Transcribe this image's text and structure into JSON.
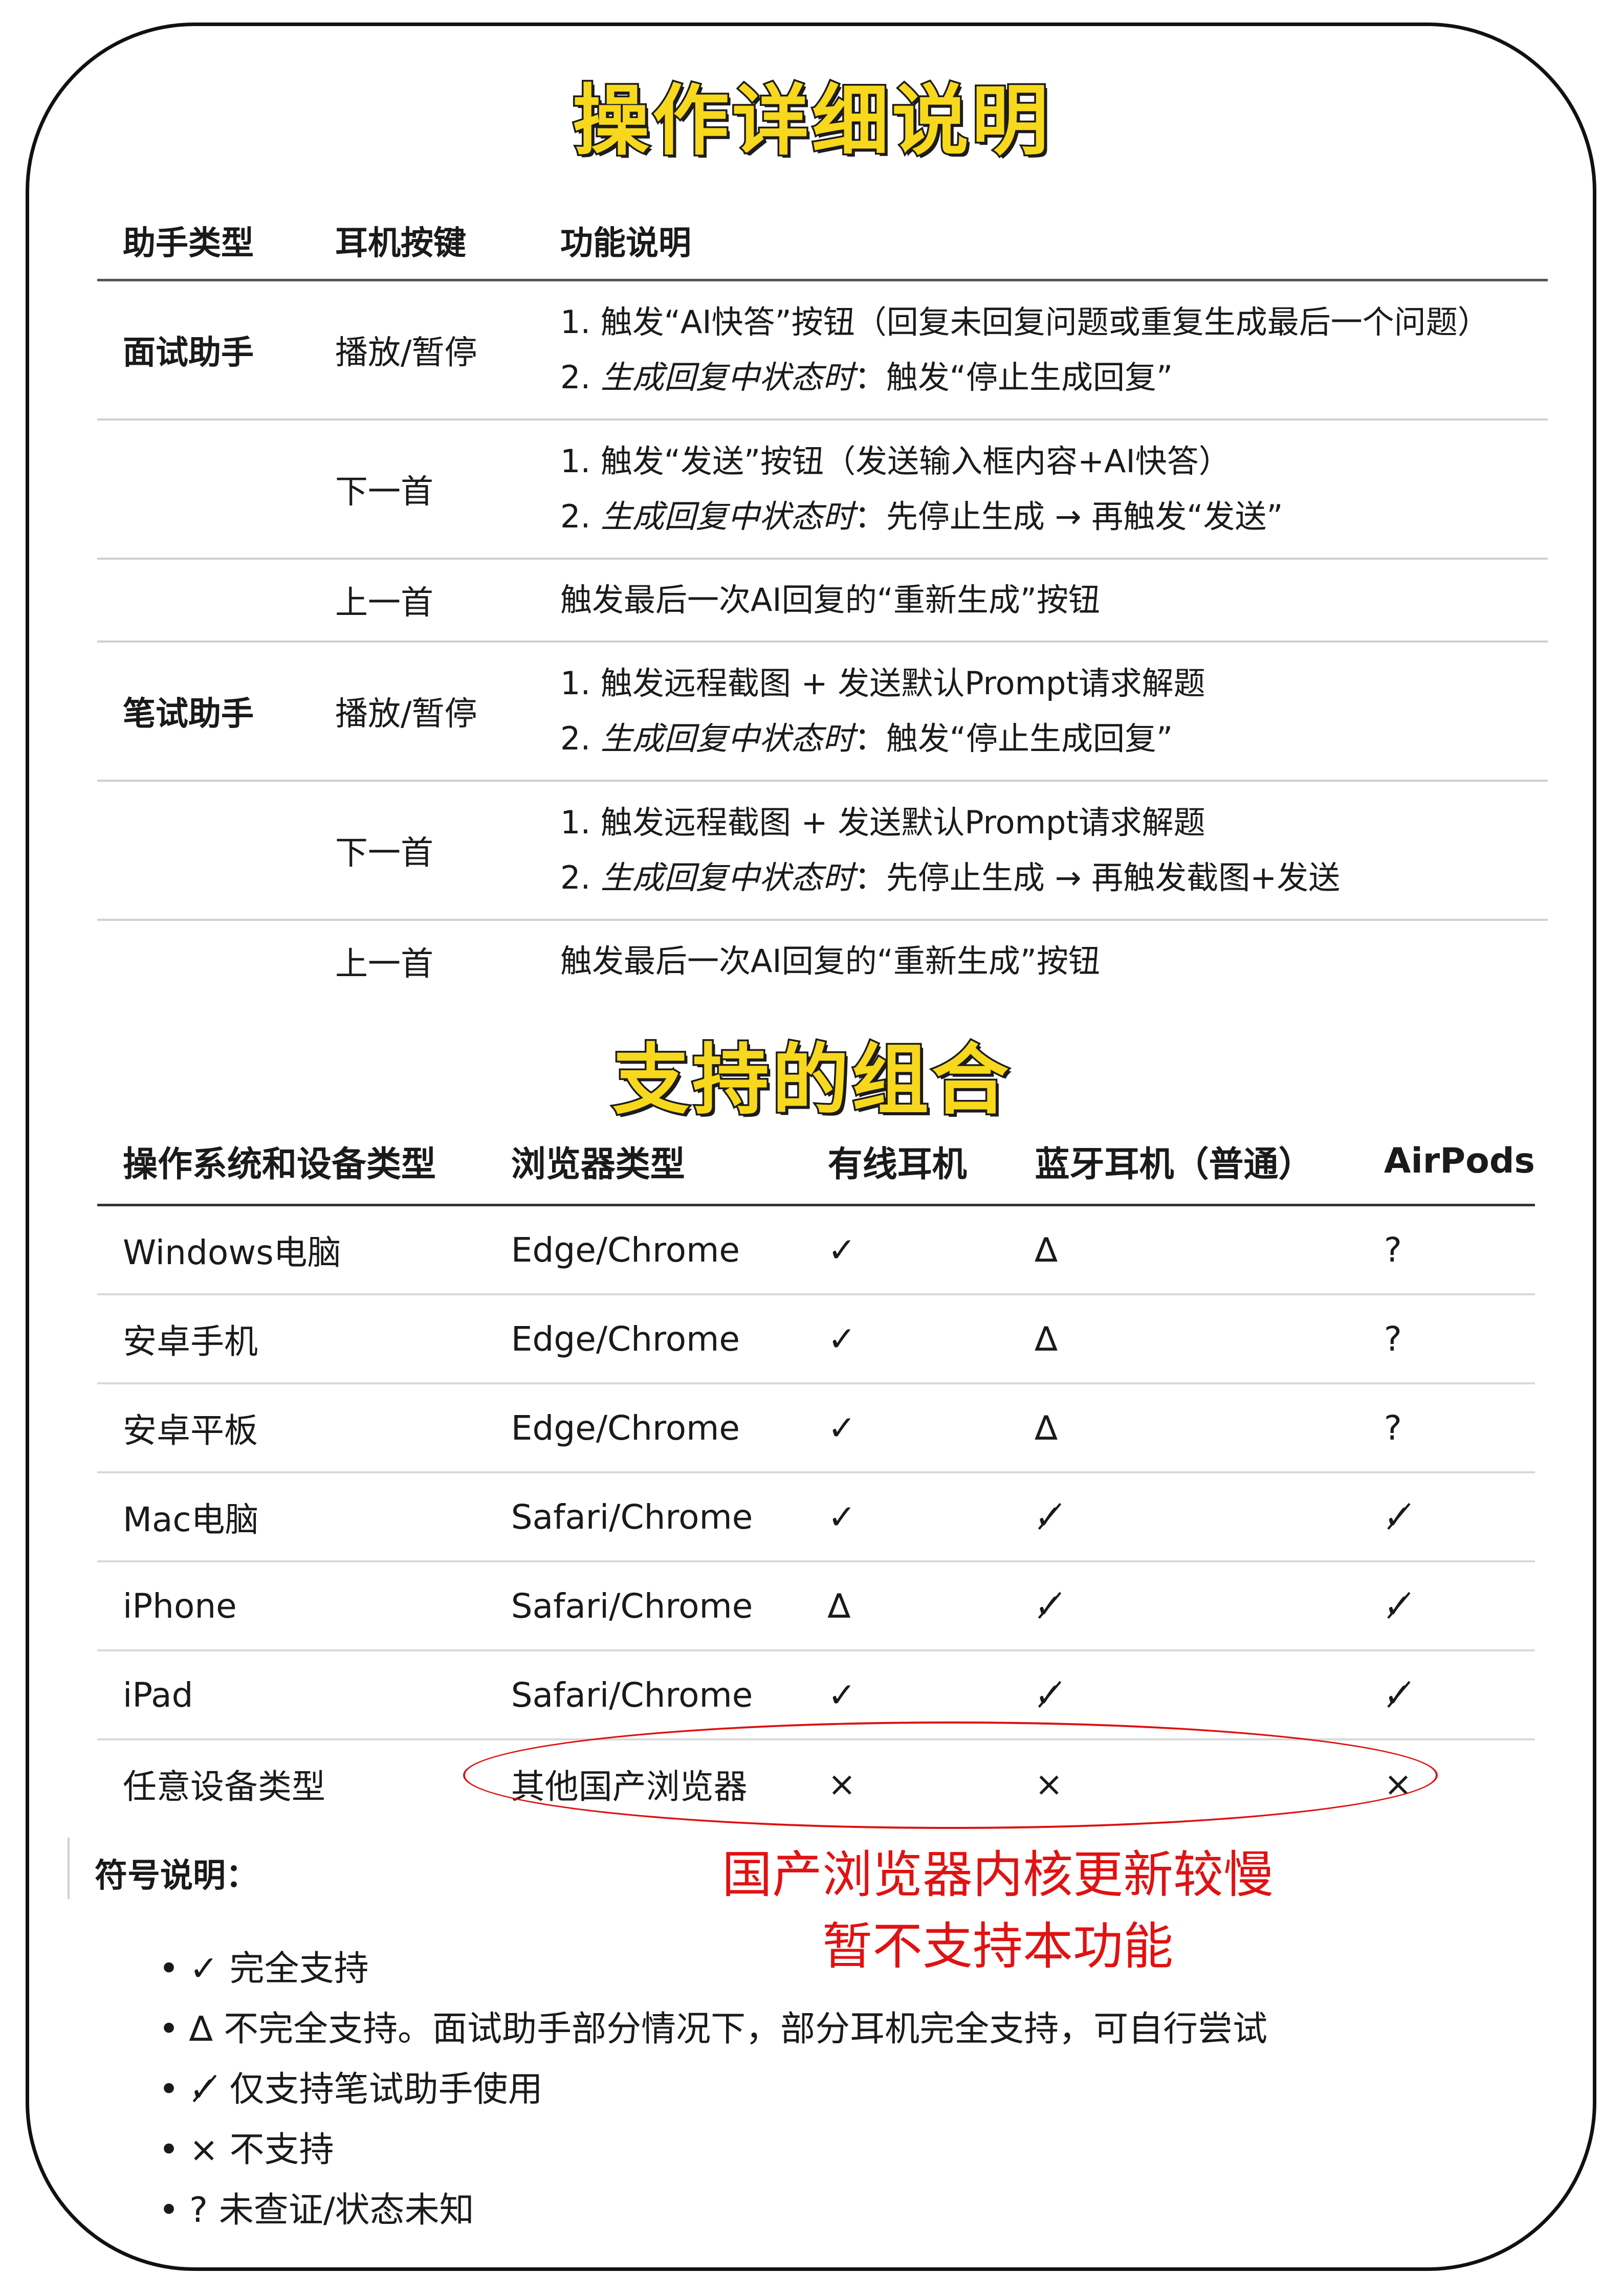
{
  "titles": {
    "ops": "操作详细说明",
    "combo": "支持的组合"
  },
  "ops_table": {
    "headers": [
      "助手类型",
      "耳机按键",
      "功能说明"
    ],
    "rows": [
      {
        "assistant": "面试助手",
        "key": "播放/暂停",
        "line1": "1. 触发“AI快答”按钮（回复未回复问题或重复生成最后一个问题）",
        "line2_num": "2. ",
        "line2_em": "生成回复中状态时",
        "line2_rest": "：触发“停止生成回复”"
      },
      {
        "assistant": "",
        "key": "下一首",
        "line1": "1. 触发“发送”按钮（发送输入框内容+AI快答）",
        "line2_num": "2. ",
        "line2_em": "生成回复中状态时",
        "line2_rest": "：先停止生成 → 再触发“发送”"
      },
      {
        "assistant": "",
        "key": "上一首",
        "line1": "触发最后一次AI回复的“重新生成”按钮"
      },
      {
        "assistant": "笔试助手",
        "key": "播放/暂停",
        "line1": "1. 触发远程截图 + 发送默认Prompt请求解题",
        "line2_num": "2. ",
        "line2_em": "生成回复中状态时",
        "line2_rest": "：触发“停止生成回复”"
      },
      {
        "assistant": "",
        "key": "下一首",
        "line1": "1. 触发远程截图 + 发送默认Prompt请求解题",
        "line2_num": "2. ",
        "line2_em": "生成回复中状态时",
        "line2_rest": "：先停止生成 → 再触发截图+发送"
      },
      {
        "assistant": "",
        "key": "上一首",
        "line1": "触发最后一次AI回复的“重新生成”按钮"
      }
    ]
  },
  "combo_table": {
    "headers": [
      "操作系统和设备类型",
      "浏览器类型",
      "有线耳机",
      "蓝牙耳机（普通）",
      "AirPods"
    ],
    "rows": [
      [
        "Windows电脑",
        "Edge/Chrome",
        "✓",
        "∆",
        "?"
      ],
      [
        "安卓手机",
        "Edge/Chrome",
        "✓",
        "∆",
        "?"
      ],
      [
        "安卓平板",
        "Edge/Chrome",
        "✓",
        "∆",
        "?"
      ],
      [
        "Mac电脑",
        "Safari/Chrome",
        "✓",
        "✓̸",
        "✓̸"
      ],
      [
        "iPhone",
        "Safari/Chrome",
        "∆",
        "✓̸",
        "✓̸"
      ],
      [
        "iPad",
        "Safari/Chrome",
        "✓",
        "✓̸",
        "✓̸"
      ],
      [
        "任意设备类型",
        "其他国产浏览器",
        "×",
        "×",
        "×"
      ]
    ]
  },
  "legend": {
    "title": "符号说明：",
    "items": [
      "✓ 完全支持",
      "∆ 不完全支持。面试助手部分情况下，部分耳机完全支持，可自行尝试",
      "✓̸ 仅支持笔试助手使用",
      "× 不支持",
      "? 未查证/状态未知"
    ]
  },
  "annotation": {
    "line1": "国产浏览器内核更新较慢",
    "line2": "暂不支持本功能",
    "color": "#e01212"
  },
  "colors": {
    "banner_fill": "#f8d81c",
    "banner_stroke": "#1c1c1c"
  }
}
